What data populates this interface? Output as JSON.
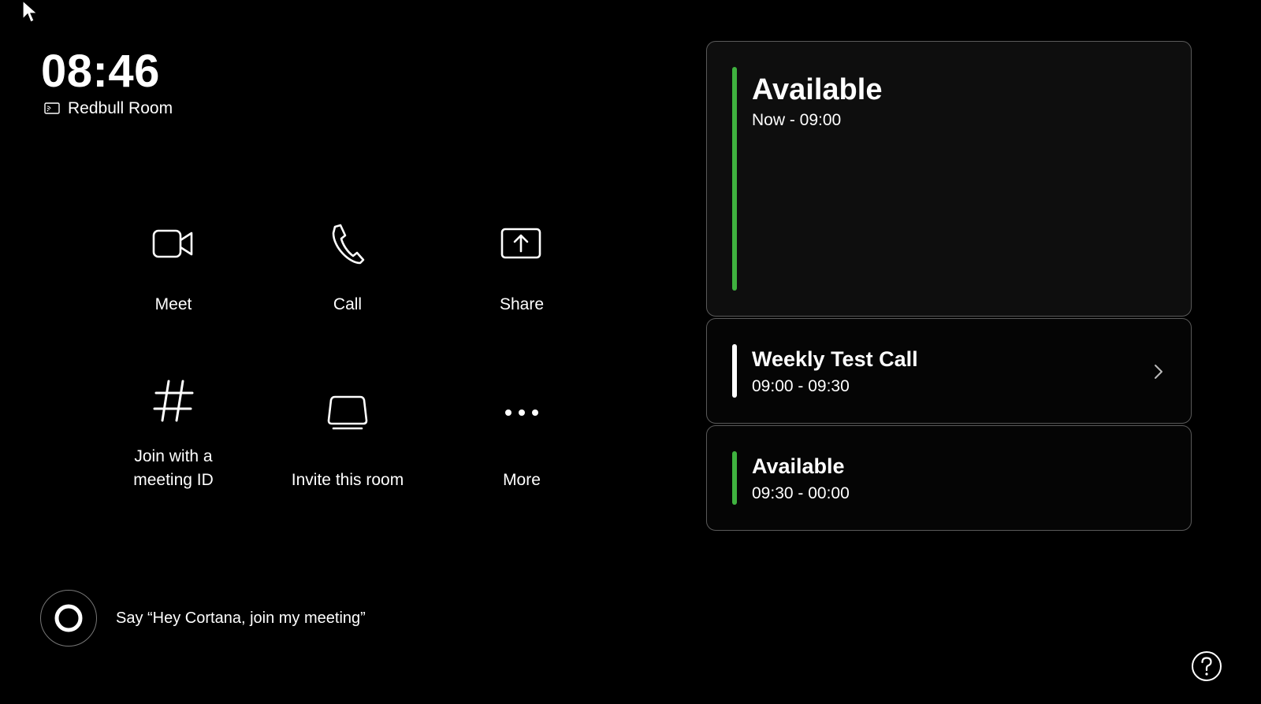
{
  "clock": {
    "time": "08:46"
  },
  "room": {
    "name": "Redbull Room",
    "icon": "room-display-icon"
  },
  "actions": [
    {
      "label": "Meet",
      "icon": "video-camera-icon"
    },
    {
      "label": "Call",
      "icon": "phone-icon"
    },
    {
      "label": "Share",
      "icon": "share-screen-icon"
    },
    {
      "label": "Join with a\nmeeting ID",
      "icon": "hash-icon"
    },
    {
      "label": "Invite this room",
      "icon": "room-device-icon"
    },
    {
      "label": "More",
      "icon": "more-dots-icon"
    }
  ],
  "agenda": [
    {
      "title": "Available",
      "time": "Now - 09:00",
      "status_color": "#3fb23f"
    },
    {
      "title": "Weekly Test Call",
      "time": "09:00 - 09:30",
      "status_color": "#ffffff",
      "icon": "chevron-right-icon"
    },
    {
      "title": "Available",
      "time": "09:30 - 00:00",
      "status_color": "#3fb23f"
    }
  ],
  "cortana": {
    "hint": "Say “Hey Cortana, join my meeting”",
    "icon": "cortana-ring-icon"
  },
  "help": {
    "icon": "help-icon"
  }
}
